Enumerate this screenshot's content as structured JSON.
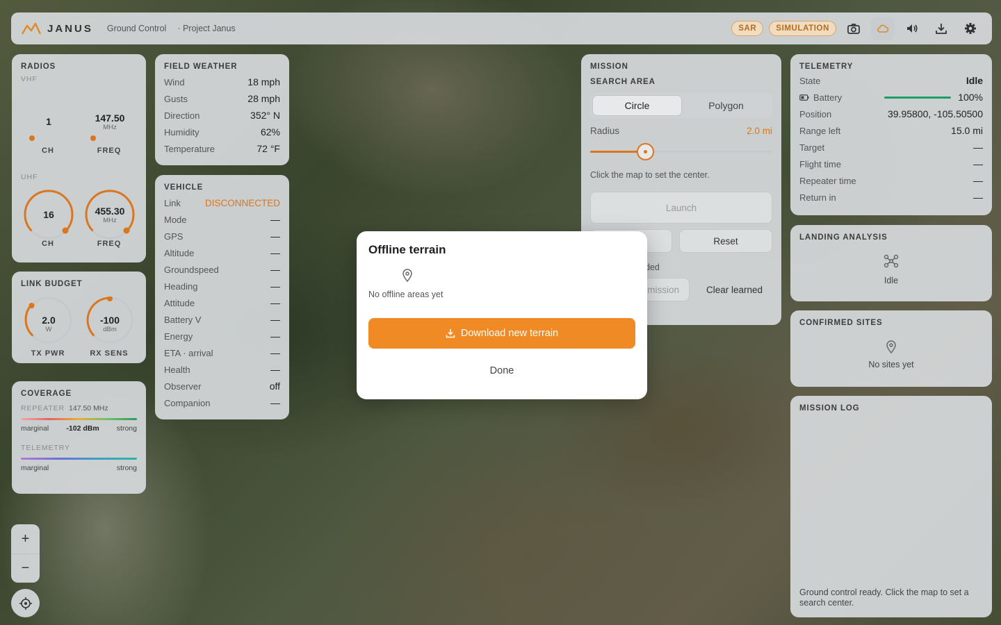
{
  "header": {
    "brand": "JANUS",
    "subtitle": "Ground Control",
    "project": "· Project Janus",
    "pill_sar": "SAR",
    "pill_sim": "SIMULATION",
    "icons": [
      "camera-icon",
      "cloud-icon",
      "volume-icon",
      "download-icon",
      "gear-icon"
    ]
  },
  "radios": {
    "title": "RADIOS",
    "vhf_label": "VHF",
    "uhf_label": "UHF",
    "vhf_ch": "1",
    "vhf_freq": "147.50",
    "uhf_ch": "16",
    "uhf_freq": "455.30",
    "unit_mhz": "MHz",
    "label_ch": "CH",
    "label_freq": "FREQ"
  },
  "link_budget": {
    "title": "LINK BUDGET",
    "tx_value": "2.0",
    "tx_unit": "W",
    "tx_label": "TX PWR",
    "rx_value": "-100",
    "rx_unit": "dBm",
    "rx_label": "RX SENS"
  },
  "coverage": {
    "title": "COVERAGE",
    "repeater_label": "REPEATER",
    "repeater_freq": "147.50 MHz",
    "marginal": "marginal",
    "strong": "strong",
    "signal": "-102 dBm",
    "telemetry_label": "TELEMETRY"
  },
  "weather": {
    "title": "FIELD WEATHER",
    "rows": [
      {
        "k": "Wind",
        "v": "18 mph"
      },
      {
        "k": "Gusts",
        "v": "28 mph"
      },
      {
        "k": "Direction",
        "v": "352° N"
      },
      {
        "k": "Humidity",
        "v": "62%"
      },
      {
        "k": "Temperature",
        "v": "72 °F"
      }
    ]
  },
  "vehicle": {
    "title": "VEHICLE",
    "link_k": "Link",
    "link_v": "DISCONNECTED",
    "rows": [
      {
        "k": "Mode",
        "v": "—"
      },
      {
        "k": "GPS",
        "v": "—"
      },
      {
        "k": "Altitude",
        "v": "—"
      },
      {
        "k": "Groundspeed",
        "v": "—"
      },
      {
        "k": "Heading",
        "v": "—"
      },
      {
        "k": "Attitude",
        "v": "—"
      },
      {
        "k": "Battery V",
        "v": "—"
      },
      {
        "k": "Energy",
        "v": "—"
      },
      {
        "k": "ETA · arrival",
        "v": "—"
      },
      {
        "k": "Health",
        "v": "—"
      },
      {
        "k": "Observer",
        "v": "off"
      },
      {
        "k": "Companion",
        "v": "—"
      }
    ]
  },
  "mission": {
    "title": "MISSION",
    "search_area": "SEARCH AREA",
    "seg_circle": "Circle",
    "seg_polygon": "Polygon",
    "radius_label": "Radius",
    "radius_value": "2.0 mi",
    "radius_fraction": 0.3,
    "hint": "Click the map to set the center.",
    "launch": "Launch",
    "reset": "Reset",
    "partial_text": "ded",
    "partial_button": "mission",
    "clear_learned": "Clear learned"
  },
  "telemetry": {
    "title": "TELEMETRY",
    "state_k": "State",
    "state_v": "Idle",
    "battery_k": "Battery",
    "battery_v": "100%",
    "battery_fraction": 1.0,
    "rows": [
      {
        "k": "Position",
        "v": "39.95800, -105.50500"
      },
      {
        "k": "Range left",
        "v": "15.0 mi"
      },
      {
        "k": "Target",
        "v": "—"
      },
      {
        "k": "Flight time",
        "v": "—"
      },
      {
        "k": "Repeater time",
        "v": "—"
      },
      {
        "k": "Return in",
        "v": "—"
      }
    ]
  },
  "landing": {
    "title": "LANDING ANALYSIS",
    "status": "Idle"
  },
  "sites": {
    "title": "CONFIRMED SITES",
    "empty": "No sites yet"
  },
  "log": {
    "title": "MISSION LOG",
    "message": "Ground control ready. Click the map to set a search center."
  },
  "modal": {
    "title": "Offline terrain",
    "empty": "No offline areas yet",
    "download": "Download new terrain",
    "done": "Done"
  },
  "map_controls": {
    "zoom_in": "+",
    "zoom_out": "−"
  },
  "colors": {
    "accent": "#ef8a25",
    "battery": "#1e9c6a"
  }
}
